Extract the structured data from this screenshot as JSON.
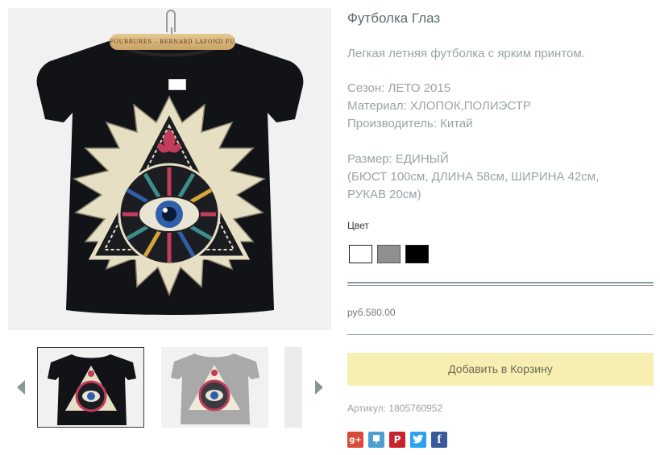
{
  "product": {
    "title": "Футболка Глаз",
    "description": "Легкая летняя футболка с ярким принтом.",
    "season": "Сезон: ЛЕТО 2015",
    "material": "Материал: ХЛОПОК,ПОЛИЭСТР",
    "manufacturer": "Производитель: Китай",
    "size": "Размер: ЕДИНЫЙ",
    "size_details_line1": "(БЮСТ 100см, ДЛИНА 58см, ШИРИНА 42см,",
    "size_details_line2": "РУКАВ 20см)",
    "color_label": "Цвет",
    "colors": [
      {
        "name": "white",
        "hex": "#ffffff",
        "selected": true
      },
      {
        "name": "gray",
        "hex": "#8f8f8f",
        "selected": false
      },
      {
        "name": "black",
        "hex": "#000000",
        "selected": false
      }
    ],
    "price": "руб.580.00",
    "add_to_cart_label": "Добавить в Корзину",
    "sku_label": "Артикул:",
    "sku_value": "1805760952"
  },
  "image": {
    "hanger_text": "FOURRURES – BERNARD LAFOND FURS",
    "shirt_color": "#121316",
    "print_colors": [
      "#e6dfc4",
      "#2e5fa8",
      "#c23c5b",
      "#3b8f8a"
    ]
  },
  "thumbnails": [
    {
      "name": "black",
      "shirt_color": "#121316",
      "active": true
    },
    {
      "name": "gray",
      "shirt_color": "#a9a9a9",
      "active": false
    },
    {
      "name": "partial",
      "shirt_color": "#ececec",
      "active": false
    }
  ],
  "share": [
    {
      "name": "google-plus",
      "glyph": "g+"
    },
    {
      "name": "vkontakte",
      "glyph": "✉"
    },
    {
      "name": "pinterest",
      "glyph": "P"
    },
    {
      "name": "twitter",
      "glyph": "t"
    },
    {
      "name": "facebook",
      "glyph": "f"
    }
  ],
  "nav": {
    "prev_icon": "chevron-left-icon",
    "next_icon": "chevron-right-icon"
  },
  "colors": {
    "accent_button": "#f7efb2",
    "text_muted": "#9aa4a5",
    "divider": "#8c9c9d"
  }
}
